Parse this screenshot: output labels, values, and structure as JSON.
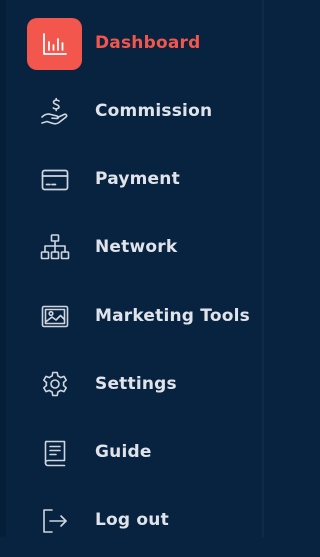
{
  "sidebar": {
    "items": [
      {
        "label": "Dashboard",
        "icon": "chart-icon",
        "active": true
      },
      {
        "label": "Commission",
        "icon": "hand-dollar-icon",
        "active": false
      },
      {
        "label": "Payment",
        "icon": "credit-card-icon",
        "active": false
      },
      {
        "label": "Network",
        "icon": "network-icon",
        "active": false
      },
      {
        "label": "Marketing Tools",
        "icon": "image-icon",
        "active": false
      },
      {
        "label": "Settings",
        "icon": "gear-icon",
        "active": false
      },
      {
        "label": "Guide",
        "icon": "book-icon",
        "active": false
      },
      {
        "label": "Log out",
        "icon": "logout-icon",
        "active": false
      }
    ]
  },
  "colors": {
    "background": "#07233f",
    "accent": "#f2564c",
    "text": "#e0e4ea",
    "icon": "#cfd6df"
  }
}
